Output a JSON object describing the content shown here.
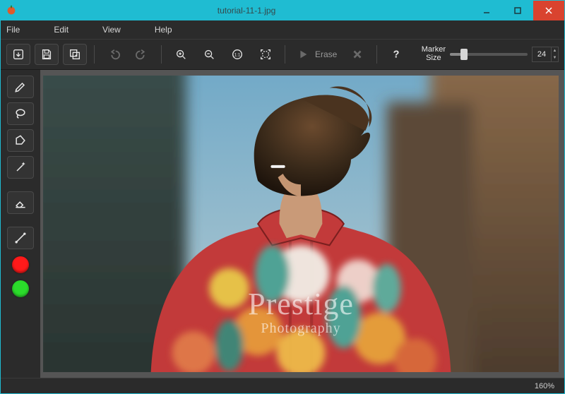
{
  "window": {
    "title": "tutorial-11-1.jpg"
  },
  "menu": {
    "file": "File",
    "edit": "Edit",
    "view": "View",
    "help": "Help"
  },
  "toolbar": {
    "erase_label": "Erase",
    "marker_label_l1": "Marker",
    "marker_label_l2": "Size",
    "marker_value": "24",
    "slider_percent": 18
  },
  "colors": {
    "accent": "#1fbcd2",
    "close": "#d9432f",
    "red_dot": "#ff1a1a",
    "green_dot": "#2bdc2b"
  },
  "watermark": {
    "line1": "Prestige",
    "line2": "Photography"
  },
  "status": {
    "zoom": "160%"
  }
}
